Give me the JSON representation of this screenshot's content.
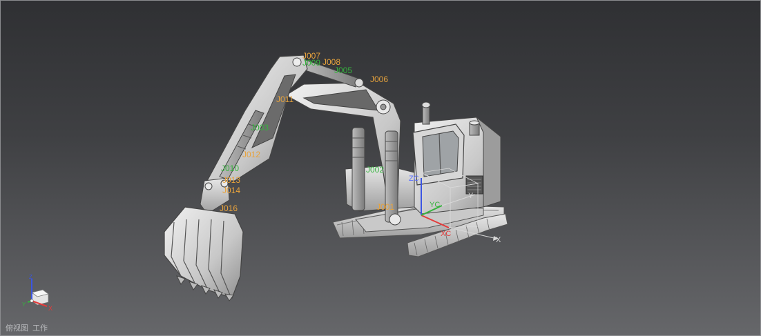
{
  "joint_labels": {
    "j007": "J007",
    "j009": "J009",
    "j008": "J008",
    "j005": "J005",
    "j006": "J006",
    "j011": "J011",
    "j003": "J003",
    "j012": "J012",
    "j010": "J010",
    "j013": "J013",
    "j014": "J014",
    "j016": "J016",
    "j002": "J002",
    "j001": "J001"
  },
  "csys": {
    "xc": "XC",
    "yc": "YC",
    "zc": "ZC",
    "x": "X",
    "y": "Y"
  },
  "view_triad": {
    "x": "X",
    "y": "Y",
    "z": "Z"
  },
  "status": {
    "view_name": "俯视图",
    "mode": "工作"
  },
  "colors": {
    "background_top": "#2f3033",
    "background_bottom": "#66676a",
    "joint_label_orange": "#e8a33c",
    "joint_label_green": "#36b33e",
    "axis_x": "#e33b3b",
    "axis_y": "#36b33e",
    "axis_z": "#3b55e3"
  }
}
